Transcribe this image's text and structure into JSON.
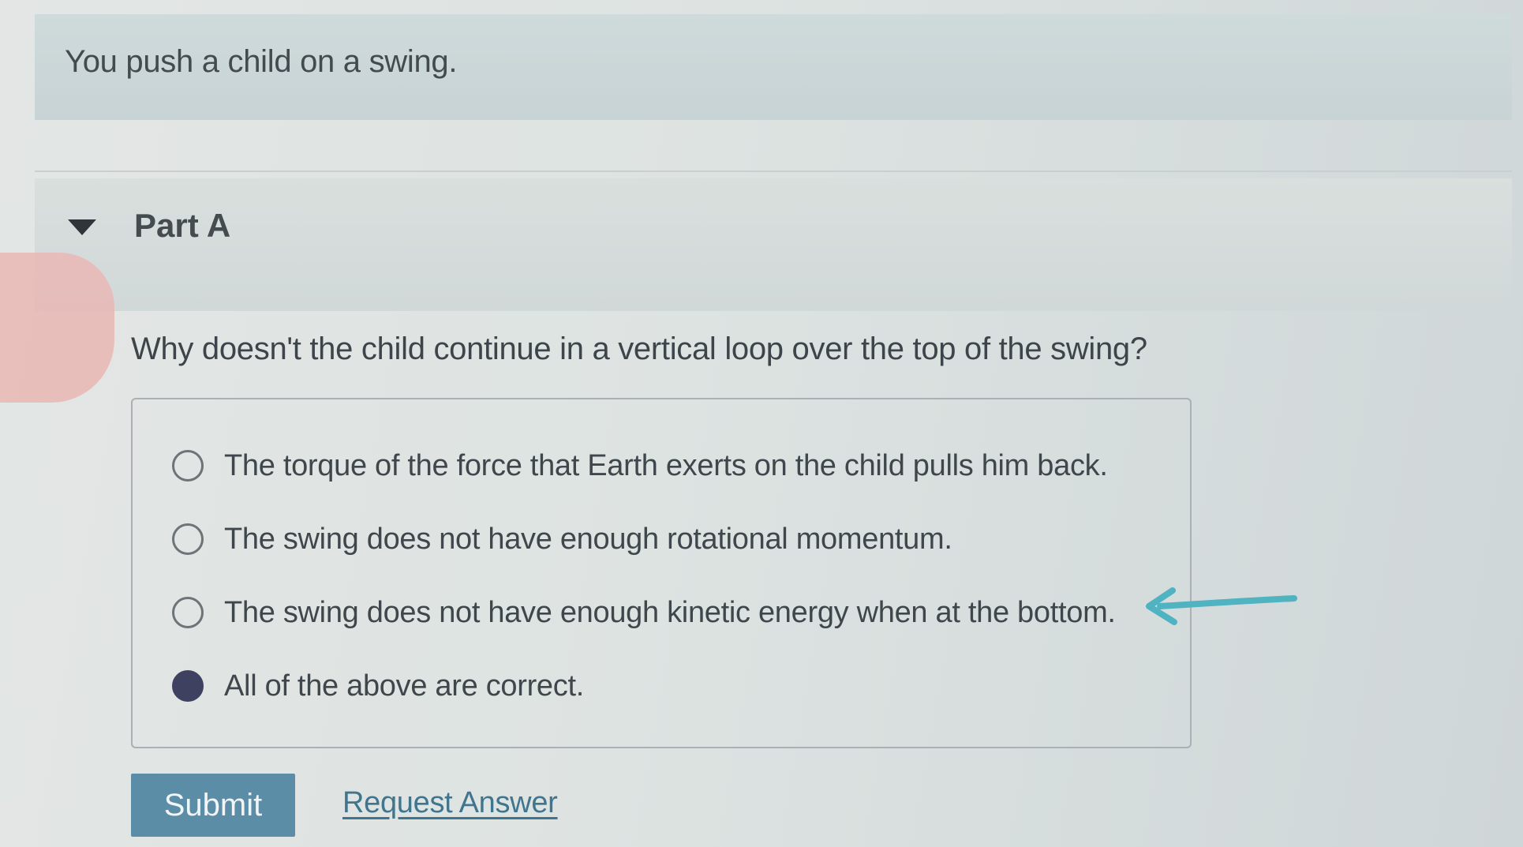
{
  "intro": {
    "text": "You push a child on a swing."
  },
  "part": {
    "title": "Part A",
    "toggle_icon": "caret-down-icon",
    "expanded": true
  },
  "question": {
    "prompt": "Why doesn't the child continue in a vertical loop over the top of the swing?",
    "choices": [
      {
        "label": "The torque of the force that Earth exerts on the child pulls him back.",
        "selected": false
      },
      {
        "label": "The swing does not have enough rotational momentum.",
        "selected": false
      },
      {
        "label": "The swing does not have enough kinetic energy when at the bottom.",
        "selected": false
      },
      {
        "label": "All of the above are correct.",
        "selected": true
      }
    ],
    "annotation": {
      "icon": "hand-drawn-arrow-icon",
      "points_to_choice": 3,
      "color": "#4fb3c1"
    }
  },
  "actions": {
    "submit_label": "Submit",
    "request_answer_label": "Request Answer"
  },
  "colors": {
    "accent": "#5b8ea6",
    "link": "#40758f",
    "selected_radio": "#3e4160"
  }
}
